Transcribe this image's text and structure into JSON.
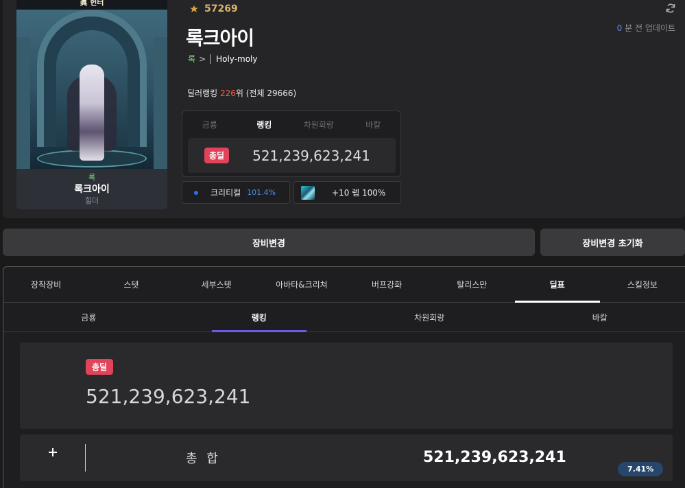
{
  "character": {
    "server_tag": "眞 헌터",
    "job_short": "록",
    "name": "록크아이",
    "subclass": "힐더"
  },
  "header": {
    "fame": "57269",
    "name": "록크아이",
    "crumb_job": "록",
    "crumb_arrow": ">",
    "guild": "Holy-moly",
    "rank_prefix": "딜러랭킹 ",
    "rank_num": "226",
    "rank_suffix": "위 (전체 29666)",
    "updated_num": "0",
    "updated_text": " 분 전 업데이트"
  },
  "damage_card": {
    "tabs": [
      {
        "label": "금룡"
      },
      {
        "label": "랭킹"
      },
      {
        "label": "차원회랑"
      },
      {
        "label": "바칼"
      }
    ],
    "badge": "총딜",
    "value": "521,239,623,241"
  },
  "mini": {
    "crit_label": "크리티컬",
    "crit_value": "101.4%",
    "level_label": "+10 렙 100%"
  },
  "buttons": {
    "change": "장비변경",
    "reset": "장비변경 초기화"
  },
  "main_tabs": [
    {
      "label": "장착장비"
    },
    {
      "label": "스텟"
    },
    {
      "label": "세부스텟"
    },
    {
      "label": "아바타&크리쳐"
    },
    {
      "label": "버프강화"
    },
    {
      "label": "탈리스만"
    },
    {
      "label": "딜표"
    },
    {
      "label": "스킬정보"
    }
  ],
  "sub_tabs": [
    {
      "label": "금룡"
    },
    {
      "label": "랭킹"
    },
    {
      "label": "차원회랑"
    },
    {
      "label": "바칼"
    }
  ],
  "total": {
    "badge": "총딜",
    "value": "521,239,623,241"
  },
  "sum_row": {
    "label": "총 합",
    "value": "521,239,623,241",
    "percent": "7.41%"
  },
  "colors": {
    "accent_red": "#e0435a",
    "accent_purple": "#6b5ce7",
    "crit_blue": "#4d8df0",
    "job_green": "#7fd37f"
  }
}
